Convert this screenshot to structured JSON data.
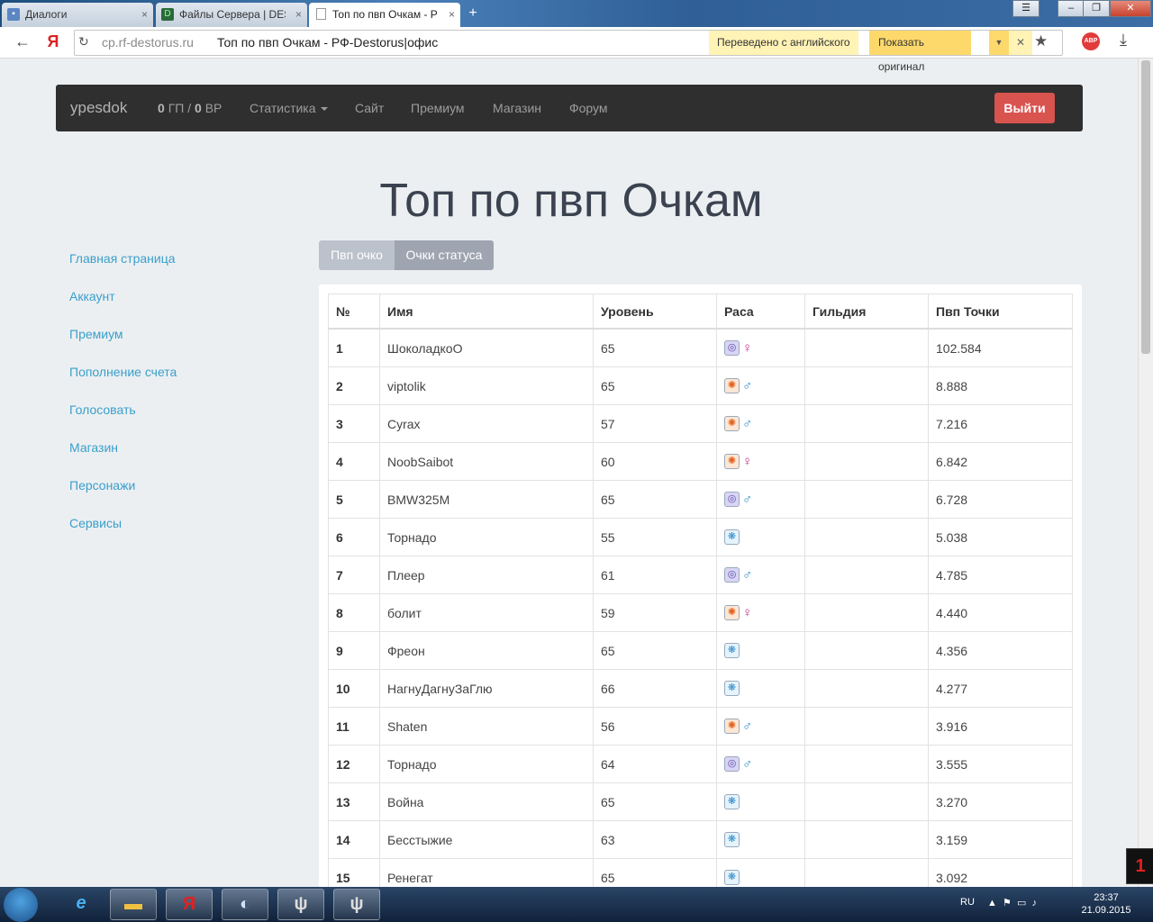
{
  "browser": {
    "tabs": [
      {
        "label": "Диалоги",
        "icon": "chat-icon",
        "active": false
      },
      {
        "label": "Файлы Сервера | DES",
        "icon": "server-files-icon",
        "active": false
      },
      {
        "label": "Топ по пвп Очкам - Р",
        "icon": "page-icon",
        "active": true
      }
    ],
    "address": {
      "domain": "cp.rf-destorus.ru",
      "page_title": "Топ по пвп Очкам - РФ-Destorus|офис"
    },
    "translate": {
      "translated_label": "Переведено с английского",
      "show_original_label": "Показать оригинал"
    },
    "abp_label": "ABP"
  },
  "site": {
    "brand": "ypesdok",
    "currency": {
      "gp_value": "0",
      "gp_label": "ГП /",
      "bp_value": "0",
      "bp_label": "ВР"
    },
    "nav": {
      "stats": "Статистика",
      "site": "Сайт",
      "premium": "Премиум",
      "shop": "Магазин",
      "forum": "Форум"
    },
    "logout_label": "Выйти"
  },
  "page": {
    "title": "Топ по пвп Очкам",
    "sidebar": [
      "Главная страница",
      "Аккаунт",
      "Премиум",
      "Пополнение счета",
      "Голосовать",
      "Магазин",
      "Персонажи",
      "Сервисы"
    ],
    "tabs": [
      "Пвп очко",
      "Очки статуса"
    ],
    "table": {
      "headers": [
        "№",
        "Имя",
        "Уровень",
        "Раса",
        "Гильдия",
        "Пвп Точки"
      ],
      "rows": [
        {
          "n": "1",
          "name": "ШоколадкоО",
          "level": "65",
          "race": "accretia",
          "sex": "female",
          "guild": "",
          "points": "102.584"
        },
        {
          "n": "2",
          "name": "viptolik",
          "level": "65",
          "race": "bellato",
          "sex": "male",
          "guild": "",
          "points": "8.888"
        },
        {
          "n": "3",
          "name": "Cyrax",
          "level": "57",
          "race": "bellato",
          "sex": "male",
          "guild": "",
          "points": "7.216"
        },
        {
          "n": "4",
          "name": "NoobSaibot",
          "level": "60",
          "race": "bellato",
          "sex": "female",
          "guild": "",
          "points": "6.842"
        },
        {
          "n": "5",
          "name": "BMW325M",
          "level": "65",
          "race": "accretia",
          "sex": "male",
          "guild": "",
          "points": "6.728"
        },
        {
          "n": "6",
          "name": "Торнадо",
          "level": "55",
          "race": "cora",
          "sex": "",
          "guild": "",
          "points": "5.038"
        },
        {
          "n": "7",
          "name": "Плеер",
          "level": "61",
          "race": "accretia",
          "sex": "male",
          "guild": "",
          "points": "4.785"
        },
        {
          "n": "8",
          "name": "болит",
          "level": "59",
          "race": "bellato",
          "sex": "female",
          "guild": "",
          "points": "4.440"
        },
        {
          "n": "9",
          "name": "Фреон",
          "level": "65",
          "race": "cora",
          "sex": "",
          "guild": "",
          "points": "4.356"
        },
        {
          "n": "10",
          "name": "НагнуДагнуЗаГлю",
          "level": "66",
          "race": "cora",
          "sex": "",
          "guild": "",
          "points": "4.277"
        },
        {
          "n": "11",
          "name": "Shaten",
          "level": "56",
          "race": "bellato",
          "sex": "male",
          "guild": "",
          "points": "3.916"
        },
        {
          "n": "12",
          "name": "Торнадо",
          "level": "64",
          "race": "accretia",
          "sex": "male",
          "guild": "",
          "points": "3.555"
        },
        {
          "n": "13",
          "name": "Война",
          "level": "65",
          "race": "cora",
          "sex": "",
          "guild": "",
          "points": "3.270"
        },
        {
          "n": "14",
          "name": "Бесстыжие",
          "level": "63",
          "race": "cora",
          "sex": "",
          "guild": "",
          "points": "3.159"
        },
        {
          "n": "15",
          "name": "Ренегат",
          "level": "65",
          "race": "cora",
          "sex": "",
          "guild": "",
          "points": "3.092"
        }
      ]
    }
  },
  "taskbar": {
    "lang": "RU",
    "time": "23:37",
    "date": "21.09.2015",
    "overlay_number": "1"
  },
  "colors": {
    "link": "#3a9fcc",
    "navbar": "#2f2f2f",
    "logout": "#d9534f",
    "background": "#eceff1"
  }
}
